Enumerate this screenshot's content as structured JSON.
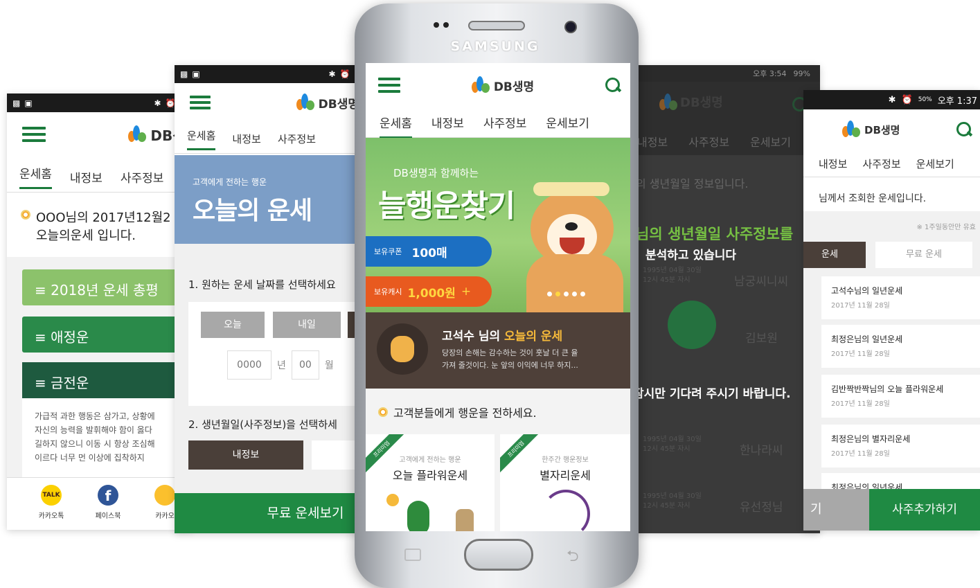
{
  "brand": {
    "logo_text": "DB생명",
    "green": "#1b7b3c",
    "light_green": "#5faf4b"
  },
  "nav_tabs": [
    "운세홈",
    "내정보",
    "사주정보",
    "운세보기"
  ],
  "screen1": {
    "notice_line1": "OOO님의 2017년12월2",
    "notice_line2": "오늘의운세 입니다.",
    "sections": [
      "≡ 2018년 운세 총평",
      "≡ 애정운",
      "≡ 금전운"
    ],
    "body_text": [
      "가급적 과한 행동은 삼가고, 상황에",
      "자신의 능력을 발휘해야 함이 옳다",
      "길하지 않으니 이동 시 항상 조심해",
      "이르다 너무 먼 이상에 집착하지"
    ],
    "share": [
      {
        "icon": "kakaotalk-icon",
        "label": "카카오톡"
      },
      {
        "icon": "facebook-icon",
        "label": "페이스북"
      },
      {
        "icon": "kakaostory-icon",
        "label": "카카오"
      }
    ]
  },
  "screen2": {
    "banner_sub": "고객에게 전하는 행운",
    "banner_title": "오늘의 운세",
    "step1": "1. 원하는 운세 날짜를 선택하세요",
    "date_buttons": [
      "오늘",
      "내일"
    ],
    "date_year_placeholder": "0000",
    "date_year_unit": "년",
    "date_month_placeholder": "00",
    "date_month_unit": "월",
    "step2": "2. 생년월일(사주정보)을 선택하세",
    "my_info_button": "내정보",
    "cta": "무료 운세보기"
  },
  "phone": {
    "brand": "SAMSUNG"
  },
  "screen3": {
    "hero_sub": "DB생명과 함께하는",
    "hero_title": "늘행운찾기",
    "coupon_label": "보유쿠폰",
    "coupon_value": "100매",
    "cash_label": "보유캐시",
    "cash_value": "1,000원",
    "cash_plus": "+",
    "fortune_name": "고석수 님의",
    "fortune_hl": "오늘의 운세",
    "fortune_text1": "당장의 손해는 감수하는 것이 훗날 더 큰 율",
    "fortune_text2": "가져 줄것이다. 눈 앞의 이익에 너무 하지...",
    "section_title": "고객분들에게 행운을 전하세요.",
    "cards": [
      {
        "badge": "프리미엄",
        "sub": "고객에게 전하는 행운",
        "title": "오늘 플라워운세"
      },
      {
        "badge": "프리미엄",
        "sub": "한주간 행운정보",
        "title": "별자리운세"
      }
    ]
  },
  "screen4": {
    "time": "오후 3:54",
    "battery": "99%",
    "tabs": [
      "내정보",
      "사주정보",
      "운세보기"
    ],
    "line1": "의 생년월일 정보입니다.",
    "line2": "님의 생년월일 사주정보를",
    "line3": "분석하고 있습니다",
    "wait": "잠시만 기다려 주시기 바랍니다.",
    "names": [
      "남궁씨니씨",
      "김보원",
      "한나라씨",
      "유선정님"
    ],
    "dates": [
      "1995년 04월 30일",
      "12시 45분 자시"
    ]
  },
  "screen5": {
    "status": "오후 1:37",
    "battery": "50%",
    "tabs": [
      "내정보",
      "사주정보",
      "운세보기"
    ],
    "head": "님께서 조회한 운세입니다.",
    "keep_note": "※ 1주일동안만 유효",
    "seg": [
      "운세",
      "무료 운세"
    ],
    "items": [
      {
        "title": "고석수님의 일년운세",
        "date": "2017년 11월 28일"
      },
      {
        "title": "최정은님의 일년운세",
        "date": "2017년 11월 28일"
      },
      {
        "title": "김반짝반짝님의 오늘 플라워운세",
        "date": "2017년 11월 28일"
      },
      {
        "title": "최정은님의 별자리운세",
        "date": "2017년 11월 28일"
      },
      {
        "title": "최정은님의 일년운세",
        "date": ""
      }
    ],
    "btn_left": "기",
    "btn_right": "사주추가하기"
  }
}
